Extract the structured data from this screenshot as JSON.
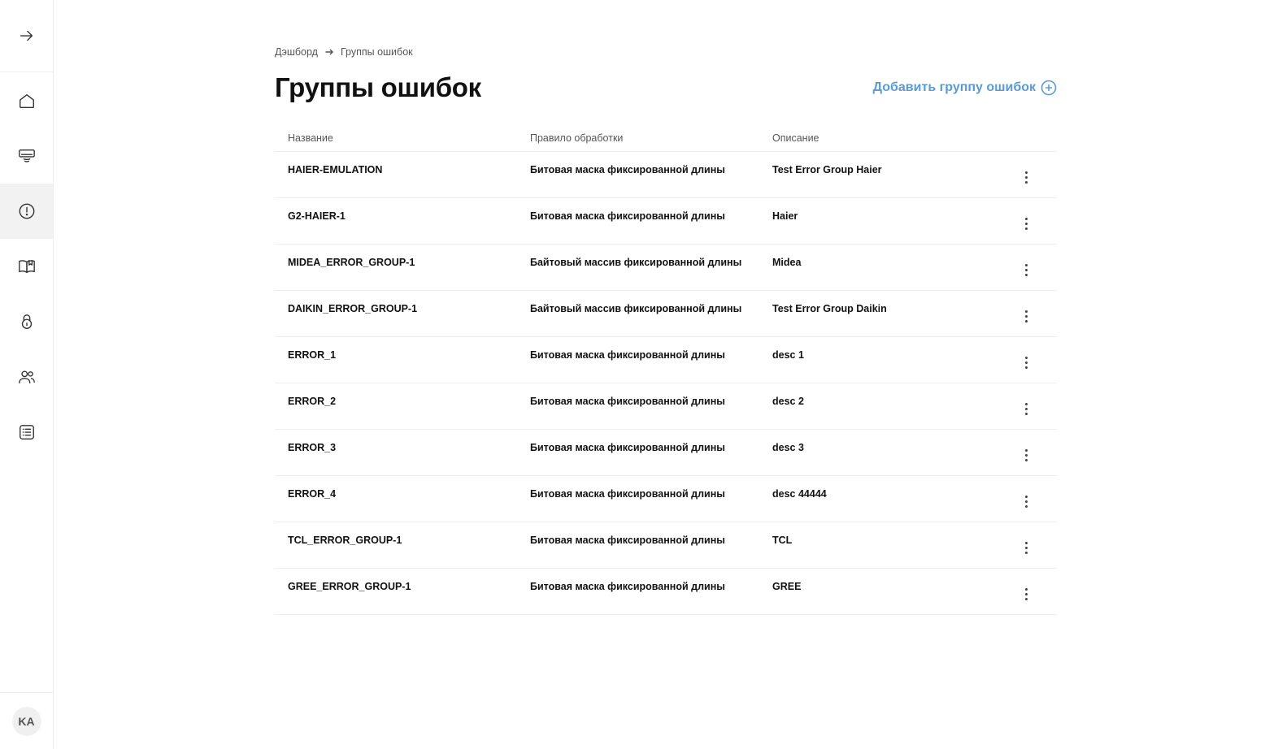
{
  "breadcrumb": {
    "home": "Дэшборд",
    "current": "Группы ошибок"
  },
  "page": {
    "title": "Группы ошибок",
    "add_button": "Добавить группу ошибок"
  },
  "sidebar": {
    "expand_icon": "arrow-right-icon",
    "items": [
      {
        "icon": "home-icon",
        "active": false
      },
      {
        "icon": "air-conditioner-icon",
        "active": false
      },
      {
        "icon": "alert-circle-icon",
        "active": true
      },
      {
        "icon": "book-icon",
        "active": false
      },
      {
        "icon": "lock-icon",
        "active": false
      },
      {
        "icon": "users-icon",
        "active": false
      },
      {
        "icon": "list-icon",
        "active": false
      }
    ],
    "avatar": "KA"
  },
  "table": {
    "headers": {
      "name": "Название",
      "rule": "Правило обработки",
      "description": "Описание"
    },
    "rows": [
      {
        "name": "HAIER-EMULATION",
        "rule": "Битовая маска фиксированной длины",
        "description": "Test Error Group Haier"
      },
      {
        "name": "G2-HAIER-1",
        "rule": "Битовая маска фиксированной длины",
        "description": "Haier"
      },
      {
        "name": "MIDEA_ERROR_GROUP-1",
        "rule": "Байтовый массив фиксированной длины",
        "description": "Midea"
      },
      {
        "name": "DAIKIN_ERROR_GROUP-1",
        "rule": "Байтовый массив фиксированной длины",
        "description": "Test Error Group Daikin"
      },
      {
        "name": "ERROR_1",
        "rule": "Битовая маска фиксированной длины",
        "description": "desc 1"
      },
      {
        "name": "ERROR_2",
        "rule": "Битовая маска фиксированной длины",
        "description": "desc 2"
      },
      {
        "name": "ERROR_3",
        "rule": "Битовая маска фиксированной длины",
        "description": "desc 3"
      },
      {
        "name": "ERROR_4",
        "rule": "Битовая маска фиксированной длины",
        "description": "desc 44444"
      },
      {
        "name": "TCL_ERROR_GROUP-1",
        "rule": "Битовая маска фиксированной длины",
        "description": "TCL"
      },
      {
        "name": "GREE_ERROR_GROUP-1",
        "rule": "Битовая маска фиксированной длины",
        "description": "GREE"
      }
    ]
  },
  "colors": {
    "accent": "#5b9bd5",
    "active_nav_bg": "#f2f2f2",
    "divider": "#eeeeee"
  }
}
